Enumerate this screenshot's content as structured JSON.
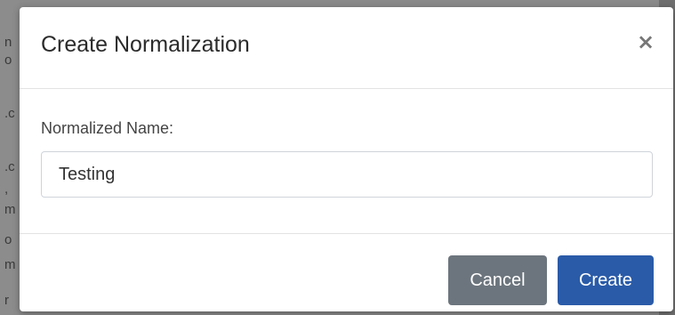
{
  "background": {
    "fragments": [
      "n",
      "o",
      "",
      ".c",
      "",
      ".c",
      ",",
      "m",
      "o",
      "m",
      "r"
    ]
  },
  "modal": {
    "title": "Create Normalization",
    "close_label": "×",
    "field_label": "Normalized Name:",
    "input_value": "Testing",
    "cancel_label": "Cancel",
    "create_label": "Create"
  },
  "colors": {
    "primary": "#2a5ba8",
    "secondary": "#6c757d"
  }
}
